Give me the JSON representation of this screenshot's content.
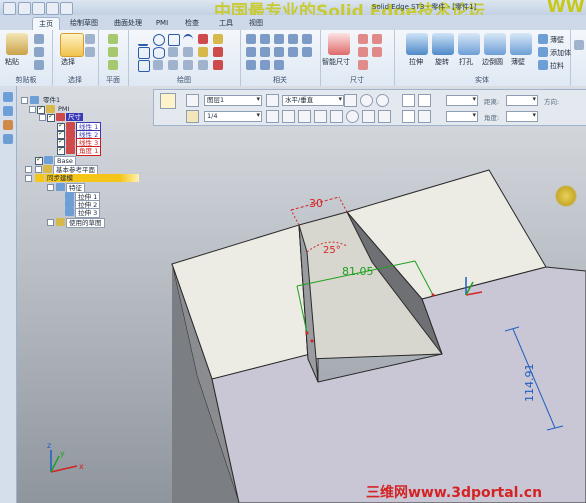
{
  "window": {
    "app_title": "Solid Edge ST3 - 零件 - [零件1]"
  },
  "watermark": {
    "text": "中国最专业的Solid Edge技术论坛",
    "www": "WW"
  },
  "tabs": [
    {
      "label": "主页",
      "active": true
    },
    {
      "label": "绘制草图"
    },
    {
      "label": "曲面处理"
    },
    {
      "label": "PMI"
    },
    {
      "label": "检查"
    },
    {
      "label": "工具"
    },
    {
      "label": "视图"
    }
  ],
  "ribbon": {
    "clipboard": {
      "label": "剪贴板",
      "paste": "粘贴"
    },
    "select": {
      "label": "选择",
      "select_btn": "选择"
    },
    "plane": {
      "label": "平面"
    },
    "draw": {
      "label": "绘图"
    },
    "relate": {
      "label": "相关"
    },
    "dimension": {
      "label": "尺寸",
      "smart_dim": "智能尺寸"
    },
    "solids": {
      "label": "实体",
      "extrude": "拉伸",
      "revolve": "旋转",
      "hole": "打孔",
      "round": "边倒圆",
      "shell": "薄壁",
      "thin": "薄壁",
      "add_body": "添加体",
      "more": "拉料"
    }
  },
  "command_bar": {
    "layer_value": "图层1",
    "plane_value": "水平/垂直",
    "style_value": "1/4",
    "fields": [
      "",
      "",
      "",
      ""
    ],
    "field_label_1": "距离:",
    "field_label_2": "角度:",
    "field_label_3": "方向:"
  },
  "tree": [
    {
      "label": "零件1",
      "level": 0,
      "checked": false,
      "color": "#1c2a3a",
      "bg": "transparent"
    },
    {
      "label": "PMI",
      "level": 1,
      "checked": true,
      "color": "#1c2a3a",
      "bg": "#ffffff"
    },
    {
      "label": "尺寸",
      "level": 2,
      "checked": true,
      "color": "#ffffff",
      "bg": "#3a3ab8"
    },
    {
      "label": "线性 1",
      "level": 3,
      "checked": true,
      "color": "#3a3ab8",
      "bg": "#ffffff"
    },
    {
      "label": "线性 2",
      "level": 3,
      "checked": true,
      "color": "#3a3ab8",
      "bg": "#ffffff"
    },
    {
      "label": "线性 3",
      "level": 3,
      "checked": true,
      "color": "#cc1f1f",
      "bg": "#ffffff"
    },
    {
      "label": "角度 1",
      "level": 3,
      "checked": true,
      "color": "#cc1f1f",
      "bg": "#ffffff"
    },
    {
      "label": "Base",
      "level": 1,
      "checked": true,
      "color": "#1c2a3a",
      "bg": "#ffffff"
    },
    {
      "label": "基本参考平面",
      "level": 1,
      "checked": false,
      "color": "#1c2a3a",
      "bg": "#ffffff"
    },
    {
      "label": "同步建模",
      "level": 1,
      "checked": false,
      "color": "#1c2a3a",
      "bg": "#f5c518"
    },
    {
      "label": "特征",
      "level": 2,
      "checked": false,
      "color": "#1c2a3a",
      "bg": "#ffffff"
    },
    {
      "label": "拉伸 1",
      "level": 3,
      "checked": false,
      "color": "#1c2a3a",
      "bg": "#ffffff"
    },
    {
      "label": "拉伸 2",
      "level": 3,
      "checked": false,
      "color": "#1c2a3a",
      "bg": "#ffffff"
    },
    {
      "label": "拉伸 3",
      "level": 3,
      "checked": false,
      "color": "#1c2a3a",
      "bg": "#ffffff"
    },
    {
      "label": "使用的草图",
      "level": 2,
      "checked": false,
      "color": "#1c2a3a",
      "bg": "#ffffff"
    }
  ],
  "dimensions": {
    "top_width": "30",
    "angle": "25°",
    "slot_length": "81.05",
    "height": "114.91"
  },
  "axes": {
    "x": "x",
    "y": "y",
    "z": "z"
  },
  "branding": {
    "text": "三维网www.3dportal.cn"
  },
  "colors": {
    "accent": "#3a3ab8",
    "dim_red": "#d42323",
    "dim_green": "#1fa01f",
    "dim_blue": "#1f5fbf",
    "highlight_yellow": "#f5c518"
  }
}
